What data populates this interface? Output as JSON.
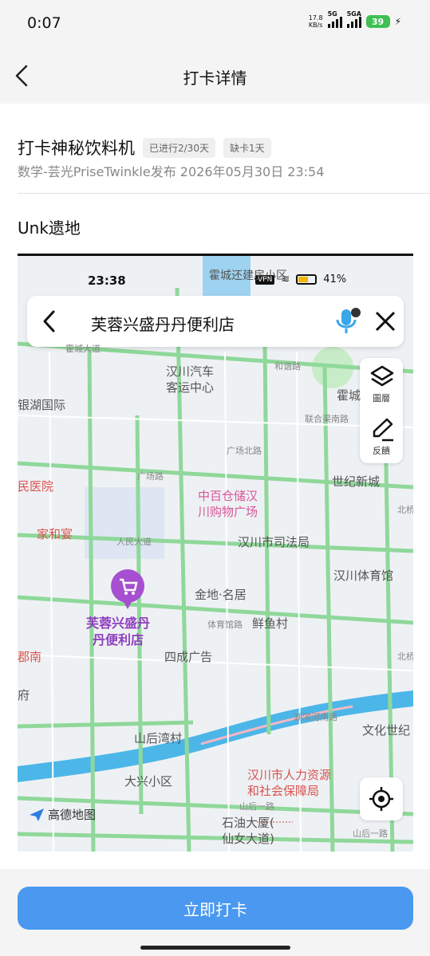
{
  "status_bar": {
    "time": "0:07",
    "net_speed_value": "17.8",
    "net_speed_unit": "KB/s",
    "signal_1": "5G",
    "signal_2": "5GA",
    "battery": "39"
  },
  "header": {
    "title": "打卡详情"
  },
  "task": {
    "title": "打卡神秘饮料机",
    "progress_tag": "已进行2/30天",
    "missing_tag": "缺卡1天",
    "meta": "数学-芸光PriseTwinkle发布 2026年05月30日 23:54"
  },
  "entry": {
    "title": "Unk遗地"
  },
  "map_screenshot": {
    "status_time": "23:38",
    "status_battery": "41%",
    "status_vpn": "VPN",
    "search_query": "芙蓉兴盛丹丹便利店",
    "layer_label": "圖層",
    "feedback_label": "反饋",
    "logo": "高德地图",
    "pin_label_1": "芙蓉兴盛丹",
    "pin_label_2": "丹便利店",
    "places": {
      "p1": "霍城还建房小区",
      "p2": "汉川汽车",
      "p2b": "客运中心",
      "p3": "银湖国际",
      "p4": "霍城",
      "p5": "联合渠南路",
      "p6": "广场北路",
      "p7": "广场路",
      "p8": "世纪新城",
      "p9": "中百仓储汉",
      "p9b": "川购物广场",
      "p10": "民医院",
      "p11": "家和宴",
      "p12": "人民大道",
      "p13": "汉川市司法局",
      "p14": "汉川体育馆",
      "p15": "金地·名居",
      "p16": "鲜鱼村",
      "p17": "体育馆路",
      "p18": "四成广告",
      "p19": "山后湾村",
      "p20": "文化世纪",
      "p21": "大兴小区",
      "p22": "汉川市人力资源",
      "p22b": "和社会保障局",
      "p23": "石油大厦(",
      "p23b": "仙女大道)",
      "p24": "湖滨河南路",
      "p25": "霍城大道",
      "p26": "和谐路",
      "p27": "北桥",
      "p28": "北桥",
      "p29": "郡南",
      "p30": "府",
      "p31": "山后一路",
      "p32": "山后一路"
    }
  },
  "action": {
    "checkin_button": "立即打卡"
  },
  "colors": {
    "primary": "#4a98f0",
    "pin": "#a64fd0",
    "road": "#8fd89a",
    "water": "#4cb6e8"
  }
}
